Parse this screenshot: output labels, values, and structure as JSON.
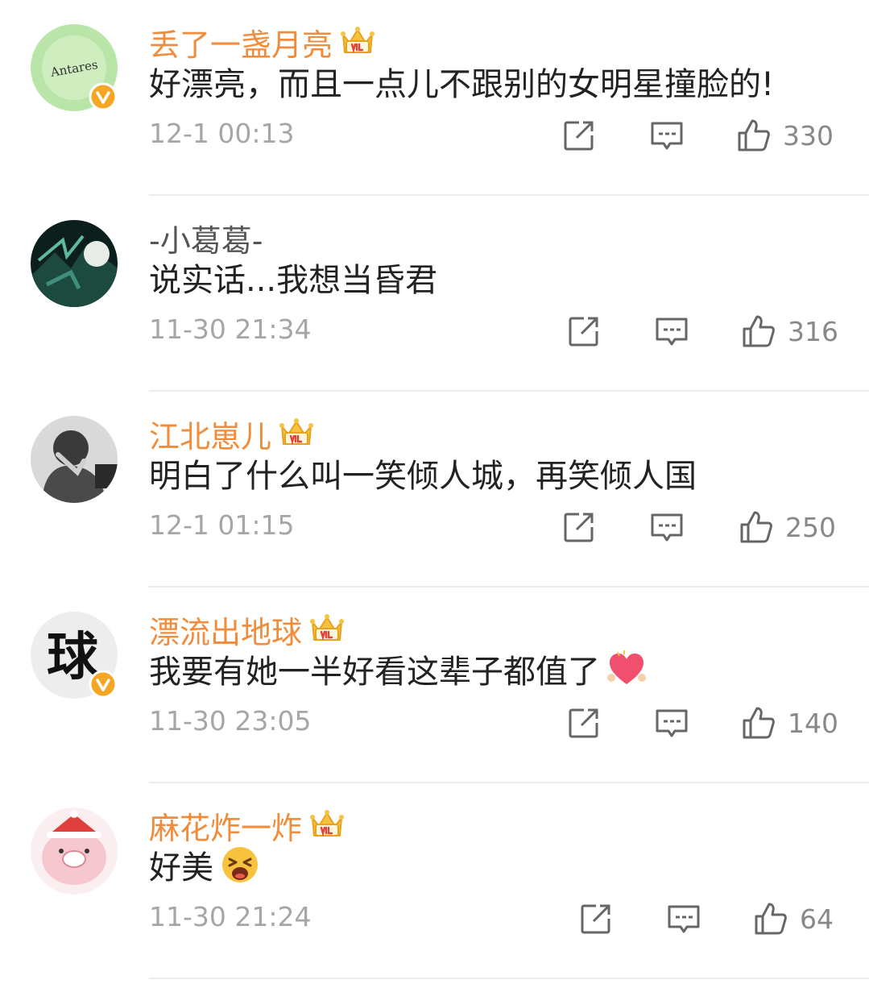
{
  "comments": [
    {
      "user": "丢了一盏月亮",
      "text": "好漂亮，而且一点儿不跟别的女明星撞脸的!",
      "time": "12-1 00:13",
      "likes": "330",
      "avatar_text": "Antares"
    },
    {
      "user": "-小葛葛-",
      "text": "说实话...我想当昏君",
      "time": "11-30 21:34",
      "likes": "316"
    },
    {
      "user": "江北崽儿",
      "text": "明白了什么叫一笑倾人城，再笑倾人国",
      "time": "12-1 01:15",
      "likes": "250"
    },
    {
      "user": "漂流出地球",
      "text": "我要有她一半好看这辈子都值了",
      "time": "11-30 23:05",
      "likes": "140",
      "avatar_text": "球"
    },
    {
      "user": "麻花炸一炸",
      "text": "好美",
      "time": "11-30 21:24",
      "likes": "64"
    }
  ],
  "icons": {
    "verified": "verified-badge-icon",
    "vip": "crown-icon",
    "share": "share-icon",
    "comment": "comment-icon",
    "like": "thumbs-up-icon"
  },
  "colors": {
    "username": "#f08c3c",
    "time": "#a6a6a6",
    "verified": "#f5a623"
  }
}
